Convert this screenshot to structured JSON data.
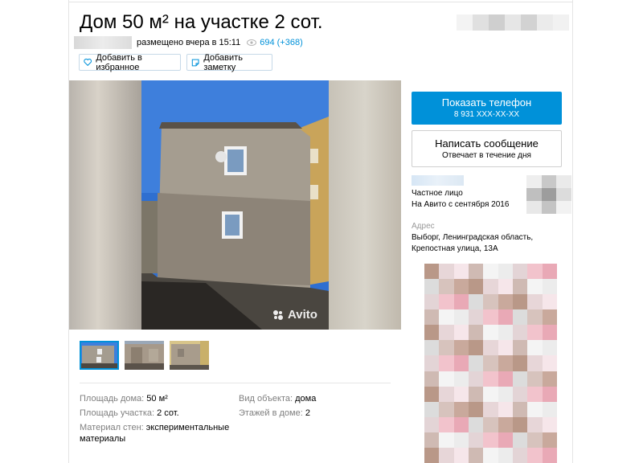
{
  "title": "Дом 50 м² на участке 2 сот.",
  "meta": {
    "posted": "размещено вчера в 15:11",
    "views": "694 (+368)"
  },
  "actions": {
    "favorite": "Добавить в избранное",
    "note": "Добавить заметку"
  },
  "gallery": {
    "watermark": "Avito",
    "thumbnails": 3,
    "active_thumbnail": 1
  },
  "params": [
    {
      "key": "Площадь дома:",
      "value": "50 м²"
    },
    {
      "key": "Вид объекта:",
      "value": "дома"
    },
    {
      "key": "Площадь участка:",
      "value": "2 сот."
    },
    {
      "key": "Этажей в доме:",
      "value": "2"
    },
    {
      "key": "Материал стен:",
      "value": "экспериментальные"
    },
    {
      "key": "",
      "value": "материалы"
    }
  ],
  "contact": {
    "phone_label": "Показать телефон",
    "phone_number": "8 931 XXX-XX-XX",
    "message_label": "Написать сообщение",
    "message_sub": "Отвечает в течение дня"
  },
  "seller": {
    "type": "Частное лицо",
    "since": "На Авито с сентября 2016"
  },
  "address": {
    "label": "Адрес",
    "line1": "Выборг, Ленинградская область,",
    "line2": "Крепостная улица, 13А"
  },
  "colors": {
    "accent": "#0091d9",
    "muted": "#7f7f7f"
  }
}
